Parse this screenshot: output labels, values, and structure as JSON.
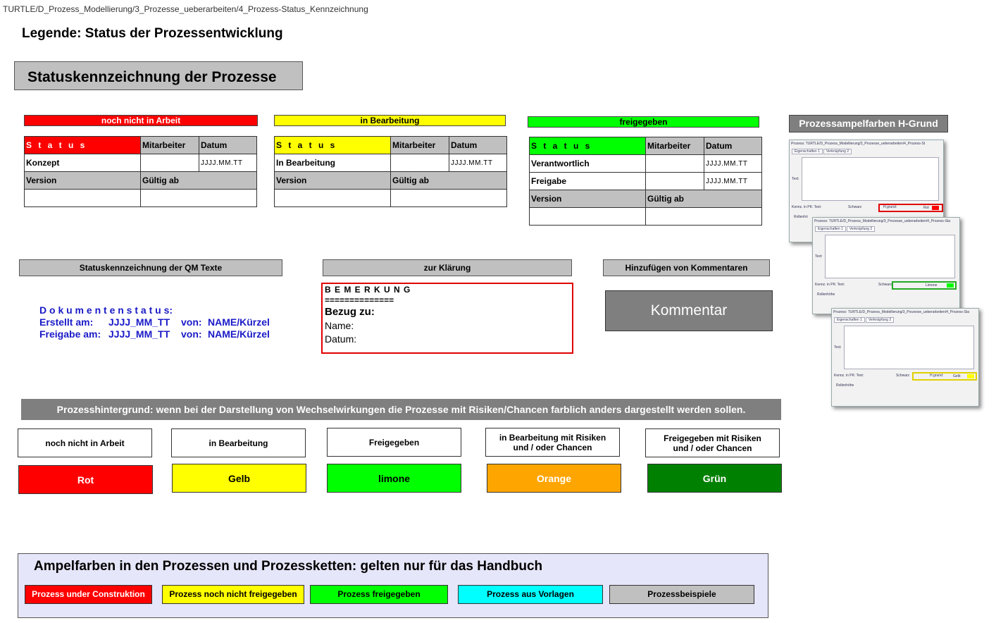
{
  "breadcrumb": "TURTLE/D_Prozess_Modellierung/3_Prozesse_ueberarbeiten/4_Prozess-Status_Kennzeichnung",
  "legend_title": "Legende: Status der Prozessentwicklung",
  "main_heading": "Statuskennzeichnung der Prozesse",
  "status_cards": [
    {
      "header": "noch nicht in Arbeit",
      "color": "#ff0000",
      "col_status": "S t a t u s",
      "col_mitarbeiter": "Mitarbeiter",
      "col_datum": "Datum",
      "rows": [
        {
          "label": "Konzept",
          "date": "JJJJ.MM.TT"
        }
      ],
      "version": "Version",
      "gueltig": "Gültig ab"
    },
    {
      "header": "in Bearbeitung",
      "color": "#ffff00",
      "col_status": "S t a t u s",
      "col_mitarbeiter": "Mitarbeiter",
      "col_datum": "Datum",
      "rows": [
        {
          "label": "In Bearbeitung",
          "date": "JJJJ.MM.TT"
        }
      ],
      "version": "Version",
      "gueltig": "Gültig ab"
    },
    {
      "header": "freigegeben",
      "color": "#00ff00",
      "col_status": "S t a t u s",
      "col_mitarbeiter": "Mitarbeiter",
      "col_datum": "Datum",
      "rows": [
        {
          "label": "Verantwortlich",
          "date": "JJJJ.MM.TT"
        },
        {
          "label": "Freigabe",
          "date": "JJJJ.MM.TT"
        }
      ],
      "version": "Version",
      "gueltig": "Gültig ab"
    }
  ],
  "qm": {
    "bar": "Statuskennzeichnung der QM Texte",
    "dokumentenstatus": "D o k u m e n t e n s t a t u s:",
    "erstellt_label": "Erstellt am:",
    "erstellt_date": "JJJJ_MM_TT",
    "freigabe_label": "Freigabe am:",
    "freigabe_date": "JJJJ_MM_TT",
    "von": "von:",
    "name": "NAME/Kürzel"
  },
  "klaerung": {
    "bar": "zur Klärung",
    "bemerkung": "B E M E R K U N G",
    "separator": "==============",
    "bezug": "Bezug zu:",
    "name": "Name:",
    "datum": "Datum:"
  },
  "kommentare": {
    "bar": "Hinzufügen von Kommentaren",
    "button": "Kommentar"
  },
  "prozesshintergrund": {
    "bar": "Prozesshintergrund: wenn bei der Darstellung von Wechselwirkungen die Prozesse mit Risiken/Chancen farblich anders dargestellt werden sollen.",
    "items": [
      {
        "label": "noch nicht in Arbeit",
        "color_name": "Rot",
        "color": "#ff0000",
        "text_color": "#ffffff"
      },
      {
        "label": "in Bearbeitung",
        "color_name": "Gelb",
        "color": "#ffff00",
        "text_color": "#000000"
      },
      {
        "label": "Freigegeben",
        "color_name": "limone",
        "color": "#00ff00",
        "text_color": "#000000"
      },
      {
        "label": "in Bearbeitung mit Risiken und / oder Chancen",
        "color_name": "Orange",
        "color": "#ffa500",
        "text_color": "#ffffff"
      },
      {
        "label": "Freigegeben mit Risiken und / oder Chancen",
        "color_name": "Grün",
        "color": "#008000",
        "text_color": "#ffffff"
      }
    ]
  },
  "ampelfarben": {
    "title": "Ampelfarben in den Prozessen und Prozessketten: gelten nur für das Handbuch",
    "items": [
      {
        "label": "Prozess under Construktion",
        "color": "#ff0000",
        "text_color": "#ffffff"
      },
      {
        "label": "Prozess  noch nicht freigegeben",
        "color": "#ffff00",
        "text_color": "#000000"
      },
      {
        "label": "Prozess  freigegeben",
        "color": "#00ff00",
        "text_color": "#000000"
      },
      {
        "label": "Prozess aus Vorlagen",
        "color": "#00ffff",
        "text_color": "#000000"
      },
      {
        "label": "Prozessbeispiele",
        "color": "#c0c0c0",
        "text_color": "#000000"
      }
    ]
  },
  "hgrund": {
    "title": "Prozessampelfarben H-Grund",
    "shots": [
      {
        "title": "Prozess: TURTLE/D_Prozess_Modellierung/3_Prozesse_ueberarbeiten/4_Prozess-St",
        "tab1": "Eigenschaften 1",
        "tab2": "Verknüpfung 2",
        "text_label": "Text:",
        "kenn": "Kennz. in PK:",
        "text2": "Text:",
        "schwarz": "Schwarz",
        "hgrund": "H.grund:",
        "value": "Rot",
        "swatch": "#ff0000",
        "rollen": "Rollenhö"
      },
      {
        "title": "Prozess: TURTLE/D_Prozess_Modellierung/3_Prozesse_ueberarbeiten/4_Prozess-Sta",
        "tab1": "Eigenschaften 1",
        "tab2": "Verknüpfung 2",
        "text_label": "Text:",
        "kenn": "Kennz. in PK:",
        "text2": "Text:",
        "schwarz": "Schwarz",
        "hgrund": "H.grund:",
        "value": "Limone",
        "swatch": "#00ff00",
        "rollen": "Rollenhöhe"
      },
      {
        "title": "Prozess: TURTLE/D_Prozess_Modellierung/3_Prozesse_ueberarbeiten/4_Prozess-Sta",
        "tab1": "Eigenschaften 1",
        "tab2": "Verknüpfung 2",
        "text_label": "Text:",
        "kenn": "Kennz. in PK:",
        "text2": "Text:",
        "schwarz": "Schwarz",
        "hgrund": "H.grund:",
        "value": "Gelb",
        "swatch": "#ffff00",
        "rollen": "Rollenhöhe"
      }
    ]
  }
}
